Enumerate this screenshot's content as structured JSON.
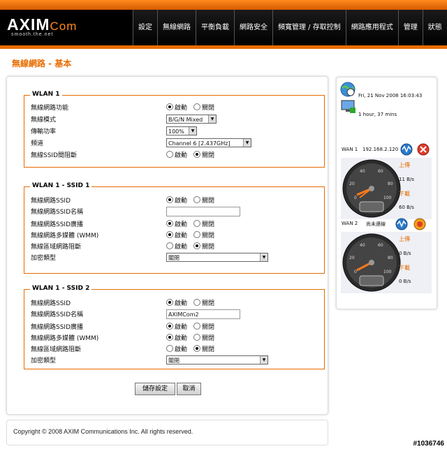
{
  "brand": {
    "logo_main": "AXIM",
    "logo_com": "Com",
    "tagline": "smooth.the.net"
  },
  "nav": [
    "設定",
    "無線網路",
    "平衡負載",
    "網路安全",
    "頻寬管理 / 存取控制",
    "網路應用程式",
    "管理",
    "狀態"
  ],
  "page_title": "無線網路 - 基本",
  "wlan1": {
    "legend": "WLAN 1",
    "rows": {
      "function": "無線網路功能",
      "mode": "無線模式",
      "power": "傳輸功率",
      "channel": "頻道",
      "isolation": "無線SSID間阻斷"
    },
    "mode_value": "B/G/N Mixed",
    "power_value": "100%",
    "channel_value": "Channel 6 [2.437GHz]"
  },
  "ssid1": {
    "legend": "WLAN 1 - SSID 1",
    "rows": {
      "ssid": "無線網路SSID",
      "name": "無線網路SSID名稱",
      "broadcast": "無線網路SSID廣播",
      "wmm": "無線網路多媒體 (WMM)",
      "isolation": "無線區域網路阻斷",
      "encryption": "加密類型"
    },
    "name_value": "",
    "encryption_value": "關閉"
  },
  "ssid2": {
    "legend": "WLAN 1 - SSID 2",
    "rows": {
      "ssid": "無線網路SSID",
      "name": "無線網路SSID名稱",
      "broadcast": "無線網路SSID廣播",
      "wmm": "無線網路多媒體 (WMM)",
      "isolation": "無線區域網路阻斷",
      "encryption": "加密類型"
    },
    "name_value": "AXIMCom2",
    "encryption_value": "關閉"
  },
  "radio": {
    "enable": "啟動",
    "disable": "關閉"
  },
  "buttons": {
    "save": "儲存設定",
    "cancel": "取消"
  },
  "footer": "Copyright © 2008 AXIM Communications Inc. All rights reserved.",
  "status": {
    "datetime": "Fri, 21 Nov 2008 16:03:43",
    "uptime": "1 hour, 37 mins",
    "wan1_label": "WAN 1",
    "wan1_ip": "192.168.2.120",
    "wan1_up_label": "上傳",
    "wan1_up_value": "11 B/s",
    "wan1_down_label": "下載",
    "wan1_down_value": "60 B/s",
    "wan2_label": "WAN 2",
    "wan2_status": "尚未連線",
    "wan2_up_label": "上傳",
    "wan2_up_value": "0 B/s",
    "wan2_down_label": "下載",
    "wan2_down_value": "0 B/s",
    "gauge_ticks": [
      "0",
      "20",
      "40",
      "60",
      "80",
      "100"
    ]
  },
  "watermark": "#1036746",
  "colors": {
    "accent": "#e86c00",
    "header": "#000000"
  }
}
